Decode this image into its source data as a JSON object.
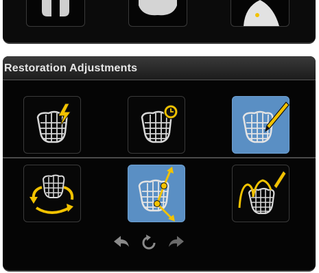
{
  "panel": {
    "title": "Restoration Adjustments"
  },
  "tools": [
    {
      "name": "crown-lightning",
      "icon": "crown-lightning-icon",
      "active": false
    },
    {
      "name": "crown-clock",
      "icon": "crown-clock-icon",
      "active": false
    },
    {
      "name": "crown-pencil",
      "icon": "crown-pencil-icon",
      "active": true
    },
    {
      "name": "crown-rotate",
      "icon": "crown-rotate-icon",
      "active": false
    },
    {
      "name": "crown-scale",
      "icon": "crown-scale-icon",
      "active": true
    },
    {
      "name": "crown-sculpt",
      "icon": "crown-sculpt-icon",
      "active": false
    }
  ],
  "history": {
    "undo_icon": "undo-arrow-icon",
    "reset_icon": "reset-icon",
    "redo_icon": "redo-arrow-icon"
  },
  "colors": {
    "accent_active": "#5a8fc4",
    "icon_yellow": "#f2c200",
    "mesh": "#d8d8d8"
  }
}
